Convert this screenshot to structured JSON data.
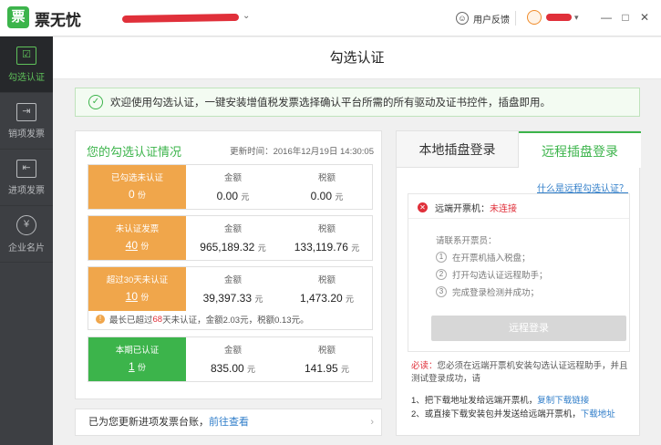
{
  "window": {
    "app_logo_char": "票",
    "app_name": "票无忧",
    "feedback_label": "用户反馈",
    "minimize": "—",
    "maximize": "□",
    "close": "✕"
  },
  "sidebar": {
    "items": [
      {
        "label": "勾选认证",
        "icon": "check-list-icon",
        "glyph": "☑"
      },
      {
        "label": "销项发票",
        "icon": "export-invoice-icon",
        "glyph": "⇥"
      },
      {
        "label": "进项发票",
        "icon": "import-invoice-icon",
        "glyph": "⇤"
      },
      {
        "label": "企业名片",
        "icon": "company-card-icon",
        "glyph": "¥"
      }
    ]
  },
  "page": {
    "title": "勾选认证",
    "banner": "欢迎使用勾选认证，一键安装增值税发票选择确认平台所需的所有驱动及证书控件，插盘即用。"
  },
  "summary": {
    "title": "您的勾选认证情况",
    "updated": "更新时间：2016年12月19日 14:30:05",
    "amount_header": "金额",
    "tax_header": "税额",
    "unit_yuan": "元",
    "unit_fen": "份",
    "rows": [
      {
        "label": "已勾选未认证",
        "count": "0",
        "amount": "0.00",
        "tax": "0.00"
      },
      {
        "label": "未认证发票",
        "count": "40",
        "amount": "965,189.32",
        "tax": "133,119.76"
      },
      {
        "label": "超过30天未认证",
        "count": "10",
        "amount": "39,397.33",
        "tax": "1,473.20"
      },
      {
        "label": "本期已认证",
        "count": "1",
        "amount": "835.00",
        "tax": "141.95"
      }
    ],
    "warning": {
      "prefix": "最长已超过",
      "days": "68",
      "suffix": "天未认证，金额2.03元，税额0.13元。"
    }
  },
  "bottom_bar": {
    "text": "已为您更新进项发票台账，",
    "link": "前往查看",
    "arrow": "›"
  },
  "right_panel": {
    "tab_local": "本地插盘登录",
    "tab_remote": "远程插盘登录",
    "help_link": "什么是远程勾选认证？",
    "status_label": "远端开票机：",
    "status_value": "未连接",
    "steps_title": "请联系开票员：",
    "steps": [
      "在开票机插入税盘；",
      "打开勾选认证远程助手；",
      "完成登录检测并成功；"
    ],
    "button": "远程登录",
    "note_prefix": "必读：",
    "note_text": "您必须在远端开票机安装勾选认证远程助手，并且测试登录成功，请",
    "dl1_text": "1、把下载地址发给远端开票机，",
    "dl1_link": "复制下载链接",
    "dl2_text": "2、或直接下载安装包并发送给远端开票机，",
    "dl2_link": "下载地址"
  },
  "colors": {
    "brand_green": "#3cb44b",
    "orange": "#f0a64b",
    "red": "#e0303a",
    "sidebar": "#3d3f43"
  }
}
